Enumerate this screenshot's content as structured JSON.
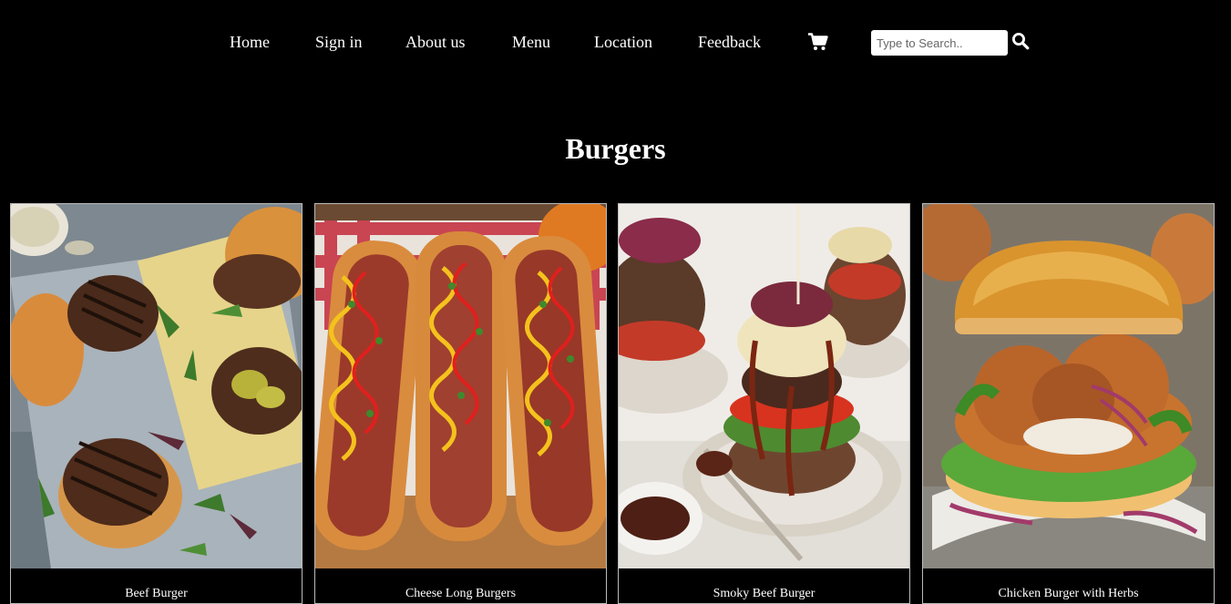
{
  "nav": {
    "links": [
      {
        "label": "Home"
      },
      {
        "label": "Sign in"
      },
      {
        "label": "About us"
      },
      {
        "label": "Menu"
      },
      {
        "label": "Location"
      },
      {
        "label": "Feedback"
      }
    ],
    "cart_icon": "cart-icon",
    "search": {
      "placeholder": "Type to Search..",
      "value": "",
      "icon": "search-icon"
    }
  },
  "page": {
    "heading": "Burgers"
  },
  "products": [
    {
      "name": "Beef Burger"
    },
    {
      "name": "Cheese Long Burgers"
    },
    {
      "name": "Smoky Beef Burger"
    },
    {
      "name": "Chicken Burger with Herbs"
    }
  ]
}
